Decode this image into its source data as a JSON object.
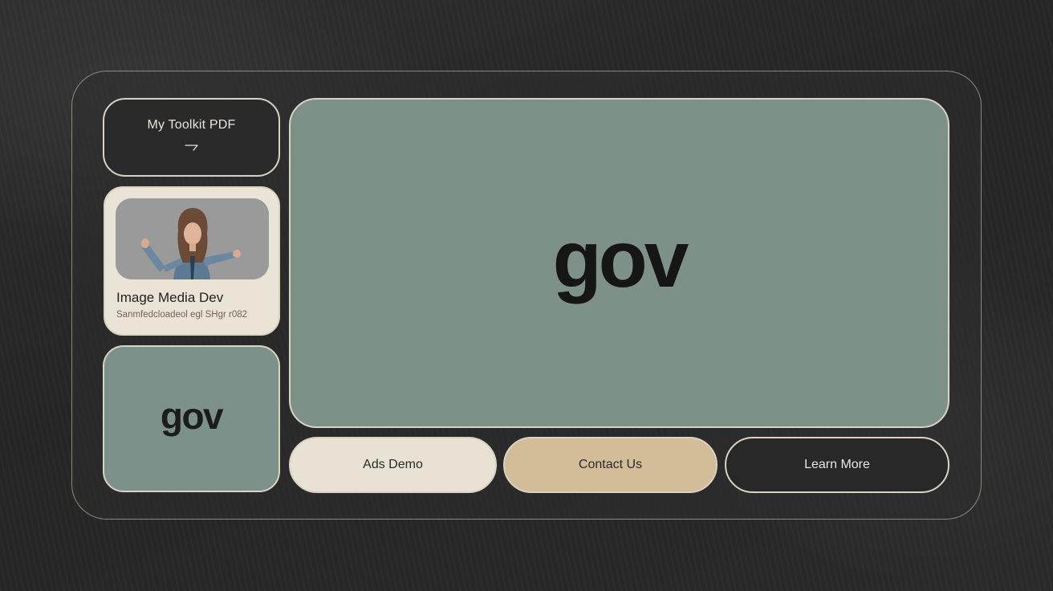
{
  "toolkit_card": {
    "label": "My Toolkit PDF",
    "icon": "arrow-icon"
  },
  "media_card": {
    "title": "Image Media Dev",
    "subtitle": "Sanmfedcloadeol egl SHgr r082",
    "image": "person-portrait"
  },
  "small_card": {
    "logo_text": "gov"
  },
  "hero": {
    "logo_text": "gov"
  },
  "buttons": {
    "ads_demo": "Ads Demo",
    "contact_us": "Contact Us",
    "learn_more": "Learn More"
  },
  "colors": {
    "background": "#262626",
    "sage": "#7d9189",
    "cream": "#e7e2d4",
    "tan": "#d2bd98",
    "dark": "#282828",
    "border": "#d9d3c2"
  }
}
